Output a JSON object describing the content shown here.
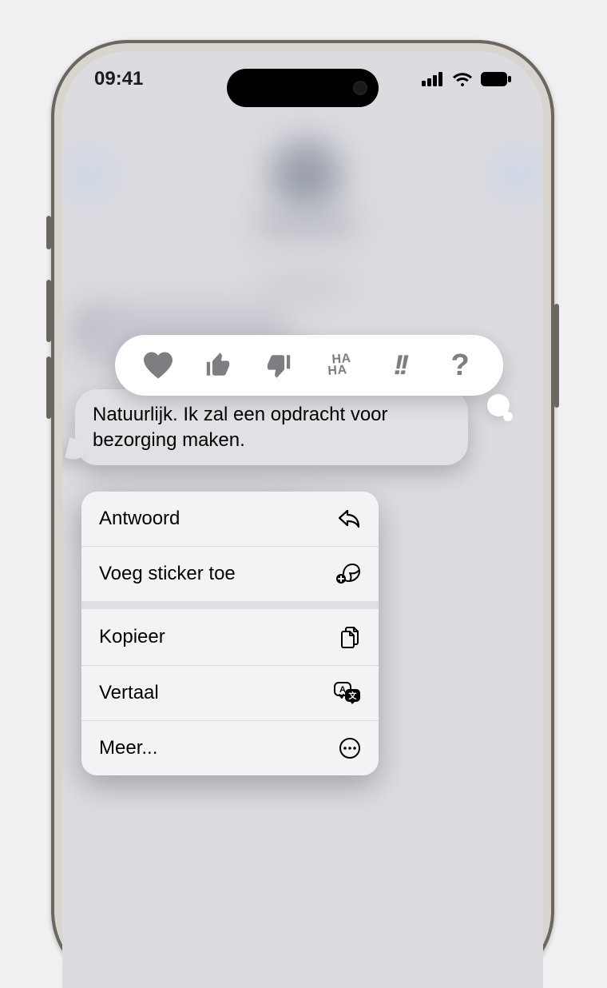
{
  "statusbar": {
    "time": "09:41"
  },
  "tapback": {
    "items": [
      {
        "name": "heart"
      },
      {
        "name": "thumbs-up"
      },
      {
        "name": "thumbs-down"
      },
      {
        "name": "haha",
        "top": "HA",
        "bottom": "HA"
      },
      {
        "name": "exclaim",
        "glyph": "!!"
      },
      {
        "name": "question",
        "glyph": "?"
      }
    ]
  },
  "message": {
    "text": "Natuurlijk. Ik zal een opdracht voor bezorging maken."
  },
  "menu": {
    "reply": "Antwoord",
    "add_sticker": "Voeg sticker toe",
    "copy": "Kopieer",
    "translate": "Vertaal",
    "more": "Meer..."
  }
}
